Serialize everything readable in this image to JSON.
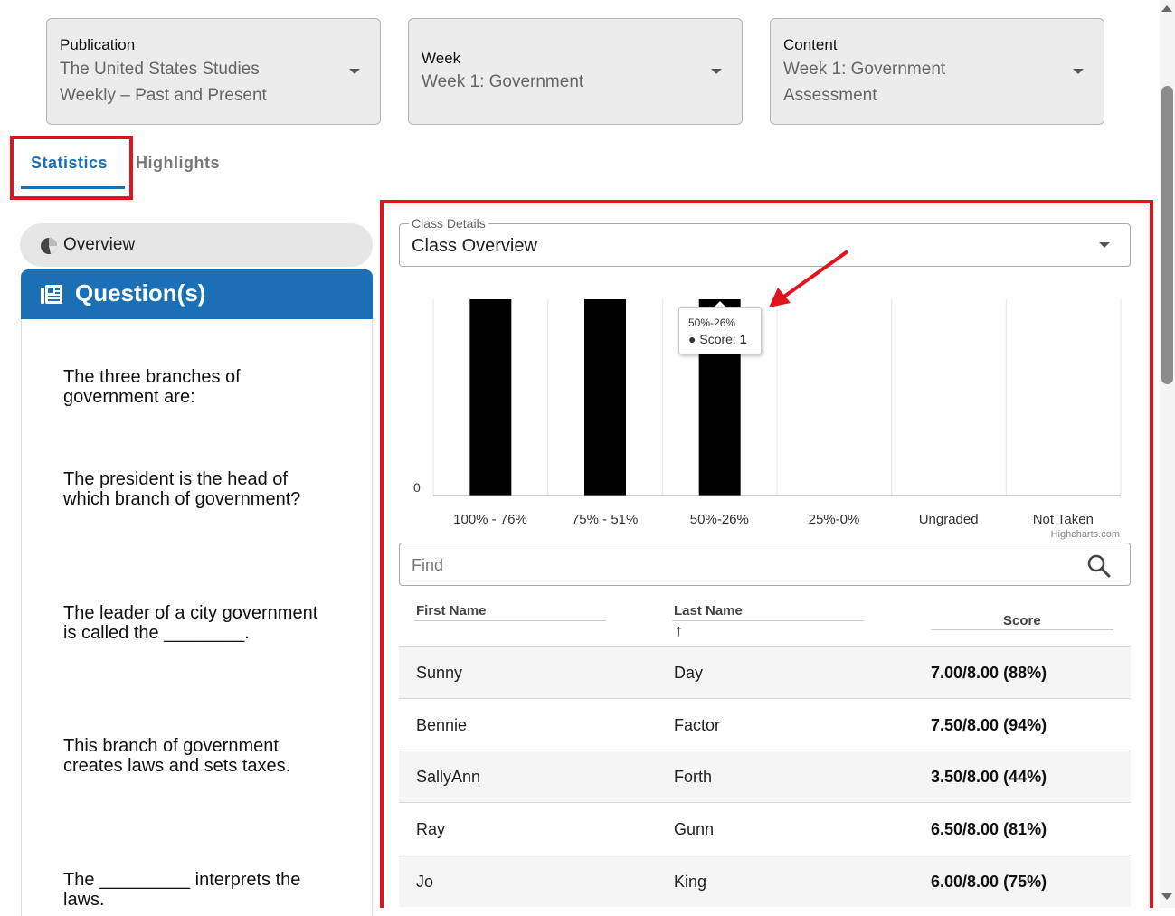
{
  "filters": {
    "publication": {
      "label": "Publication",
      "value_line1": "The United States Studies",
      "value_line2": "Weekly – Past and Present"
    },
    "week": {
      "label": "Week",
      "value": "Week 1: Government"
    },
    "content": {
      "label": "Content",
      "value_line1": "Week 1: Government",
      "value_line2": "Assessment"
    }
  },
  "tabs": {
    "statistics": "Statistics",
    "highlights": "Highlights"
  },
  "sidebar": {
    "overview_label": "Overview",
    "questions_label": "Question(s)",
    "questions": [
      {
        "line1": "The three branches of",
        "line2": "government are:"
      },
      {
        "line1": "The president is the head of",
        "line2": "which branch of government?"
      },
      {
        "line1": "The leader of a city government",
        "line2": "is called the ________."
      },
      {
        "line1": "This branch of government",
        "line2": "creates laws and sets taxes."
      },
      {
        "line1": "The _________ interprets the",
        "line2": "laws."
      }
    ]
  },
  "class_details": {
    "legend": "Class Details",
    "value": "Class Overview"
  },
  "chart_data": {
    "type": "bar",
    "categories": [
      "100% - 76%",
      "75% - 51%",
      "50%-26%",
      "25%-0%",
      "Ungraded",
      "Not Taken"
    ],
    "series": [
      {
        "name": "Score",
        "values": [
          1,
          1,
          1,
          0,
          0,
          0
        ]
      }
    ],
    "ylim": [
      0,
      1
    ],
    "y_tick_labels": [
      "0"
    ],
    "credit": "Highcharts.com",
    "bar_color": "#000000",
    "tooltip": {
      "category": "50%-26%",
      "series_label": "Score: ",
      "value": "1"
    }
  },
  "search": {
    "placeholder": "Find"
  },
  "table": {
    "columns": {
      "first": "First Name",
      "last": "Last Name",
      "score": "Score",
      "sort_arrow": "↑"
    },
    "rows": [
      {
        "first": "Sunny",
        "last": "Day",
        "score": "7.00/8.00 (88%)"
      },
      {
        "first": "Bennie",
        "last": "Factor",
        "score": "7.50/8.00 (94%)"
      },
      {
        "first": "SallyAnn",
        "last": "Forth",
        "score": "3.50/8.00 (44%)"
      },
      {
        "first": "Ray",
        "last": "Gunn",
        "score": "6.50/8.00 (81%)"
      },
      {
        "first": "Jo",
        "last": "King",
        "score": "6.00/8.00 (75%)"
      }
    ]
  },
  "colors": {
    "accent": "#1b6fb5",
    "highlight_box": "#e0141e"
  }
}
